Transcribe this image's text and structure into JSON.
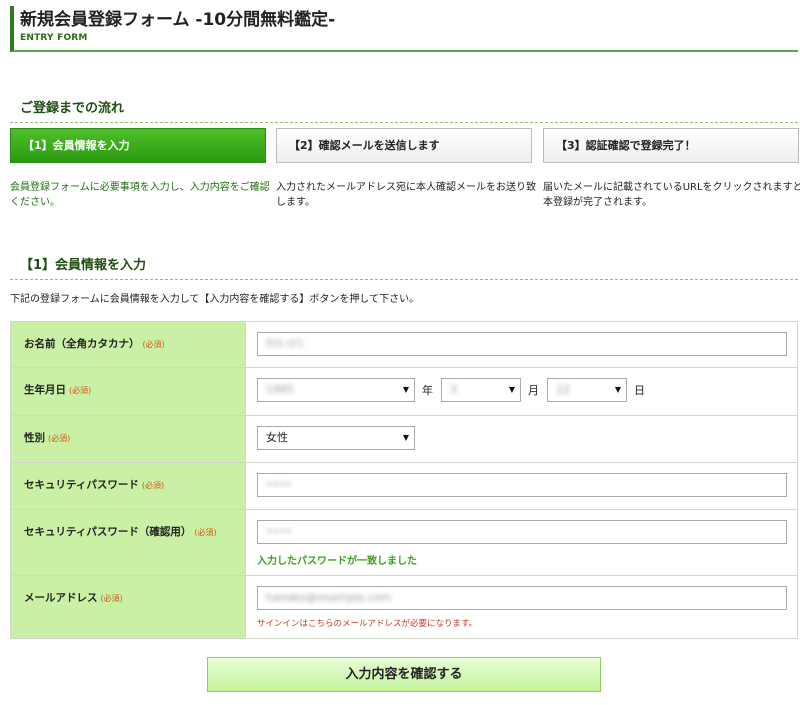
{
  "header": {
    "title": "新規会員登録フォーム -10分間無料鑑定-",
    "subtitle": "ENTRY FORM"
  },
  "flow": {
    "heading": "ご登録までの流れ",
    "steps": [
      {
        "label": "【1】会員情報を入力",
        "description": "会員登録フォームに必要事項を入力し、入力内容をご確認ください。",
        "active": true
      },
      {
        "label": "【2】確認メールを送信します",
        "description": "入力されたメールアドレス宛に本人確認メールをお送り致します。",
        "active": false
      },
      {
        "label": "【3】認証確認で登録完了！",
        "description": "届いたメールに記載されているURLをクリックされますと本登録が完了されます。",
        "active": false
      }
    ]
  },
  "form_section": {
    "heading": "【1】会員情報を入力",
    "intro": "下記の登録フォームに会員情報を入力して【入力内容を確認する】ボタンを押して下さい。"
  },
  "required_mark": "(必須)",
  "form": {
    "name": {
      "label": "お名前（全角カタカナ）",
      "value": "ﾀﾅｶ ﾊﾅｺ"
    },
    "birthdate": {
      "label": "生年月日",
      "year": "1985",
      "year_unit": "年",
      "month": "3",
      "month_unit": "月",
      "day": "12",
      "day_unit": "日"
    },
    "gender": {
      "label": "性別",
      "value": "女性"
    },
    "password": {
      "label": "セキュリティパスワード",
      "value": "••••"
    },
    "password_confirm": {
      "label": "セキュリティパスワード（確認用）",
      "value": "••••",
      "message": "入力したパスワードが一致しました"
    },
    "email": {
      "label": "メールアドレス",
      "value": "hanako@example.com",
      "note": "サインインはこちらのメールアドレスが必要になります。"
    }
  },
  "submit_label": "入力内容を確認する",
  "colors": {
    "accent": "#2c9a10",
    "label_bg": "#c9f0a4",
    "success": "#3aa01a",
    "error": "#c0392b"
  }
}
